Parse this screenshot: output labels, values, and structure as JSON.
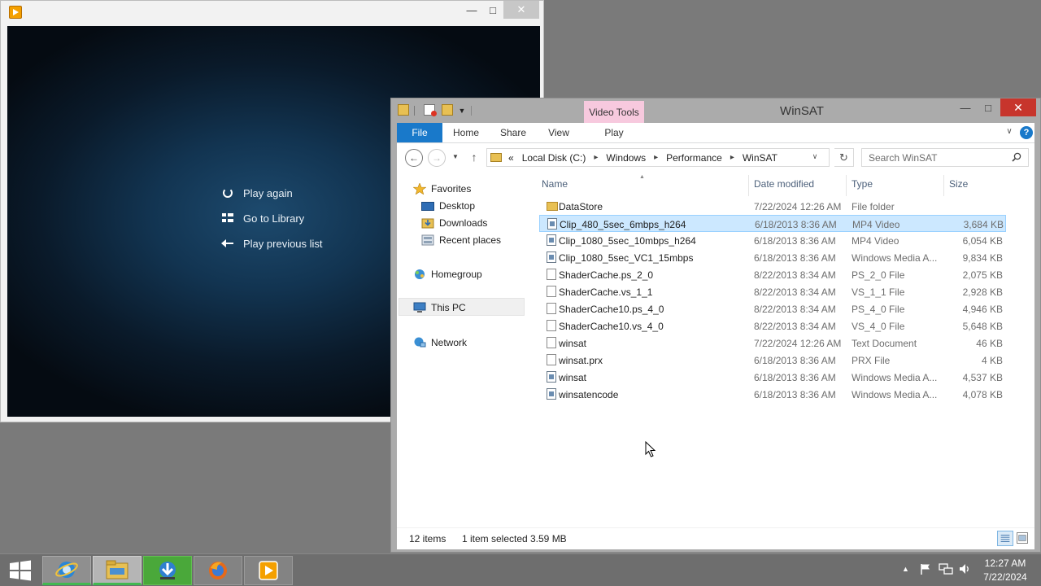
{
  "player": {
    "menu": [
      {
        "label": "Play again",
        "icon": "replay-icon"
      },
      {
        "label": "Go to Library",
        "icon": "library-icon"
      },
      {
        "label": "Play previous list",
        "icon": "back-arrow-icon"
      }
    ]
  },
  "explorer": {
    "title": "WinSAT",
    "contextual_tab_group": "Video Tools",
    "ribbon_tabs": [
      "File",
      "Home",
      "Share",
      "View",
      "Play"
    ],
    "address": {
      "overflow": "«",
      "crumbs": [
        "Local Disk (C:)",
        "Windows",
        "Performance",
        "WinSAT"
      ]
    },
    "search_placeholder": "Search WinSAT",
    "columns": {
      "name": "Name",
      "date": "Date modified",
      "type": "Type",
      "size": "Size"
    },
    "sidebar": {
      "favorites": "Favorites",
      "desktop": "Desktop",
      "downloads": "Downloads",
      "recent": "Recent places",
      "homegroup": "Homegroup",
      "this_pc": "This PC",
      "network": "Network"
    },
    "files": [
      {
        "name": "DataStore",
        "date": "7/22/2024 12:26 AM",
        "type": "File folder",
        "size": "",
        "icon": "folder-icon"
      },
      {
        "name": "Clip_480_5sec_6mbps_h264",
        "date": "6/18/2013 8:36 AM",
        "type": "MP4 Video",
        "size": "3,684 KB",
        "icon": "video-file-icon",
        "selected": true
      },
      {
        "name": "Clip_1080_5sec_10mbps_h264",
        "date": "6/18/2013 8:36 AM",
        "type": "MP4 Video",
        "size": "6,054 KB",
        "icon": "video-file-icon"
      },
      {
        "name": "Clip_1080_5sec_VC1_15mbps",
        "date": "6/18/2013 8:36 AM",
        "type": "Windows Media A...",
        "size": "9,834 KB",
        "icon": "media-file-icon"
      },
      {
        "name": "ShaderCache.ps_2_0",
        "date": "8/22/2013 8:34 AM",
        "type": "PS_2_0 File",
        "size": "2,075 KB",
        "icon": "file-icon"
      },
      {
        "name": "ShaderCache.vs_1_1",
        "date": "8/22/2013 8:34 AM",
        "type": "VS_1_1 File",
        "size": "2,928 KB",
        "icon": "file-icon"
      },
      {
        "name": "ShaderCache10.ps_4_0",
        "date": "8/22/2013 8:34 AM",
        "type": "PS_4_0 File",
        "size": "4,946 KB",
        "icon": "file-icon"
      },
      {
        "name": "ShaderCache10.vs_4_0",
        "date": "8/22/2013 8:34 AM",
        "type": "VS_4_0 File",
        "size": "5,648 KB",
        "icon": "file-icon"
      },
      {
        "name": "winsat",
        "date": "7/22/2024 12:26 AM",
        "type": "Text Document",
        "size": "46 KB",
        "icon": "file-icon"
      },
      {
        "name": "winsat.prx",
        "date": "6/18/2013 8:36 AM",
        "type": "PRX File",
        "size": "4 KB",
        "icon": "file-icon"
      },
      {
        "name": "winsat",
        "date": "6/18/2013 8:36 AM",
        "type": "Windows Media A...",
        "size": "4,537 KB",
        "icon": "media-file-icon"
      },
      {
        "name": "winsatencode",
        "date": "6/18/2013 8:36 AM",
        "type": "Windows Media A...",
        "size": "4,078 KB",
        "icon": "media-file-icon"
      }
    ],
    "status": {
      "count": "12 items",
      "selected": "1 item selected",
      "size": "3.59 MB"
    }
  },
  "taskbar": {
    "clock_time": "12:27 AM",
    "clock_date": "7/22/2024"
  },
  "colors": {
    "accent": "#1979ca",
    "close_red": "#c7352c",
    "selection": "#cce8ff",
    "context_tab": "#f7c9de"
  }
}
